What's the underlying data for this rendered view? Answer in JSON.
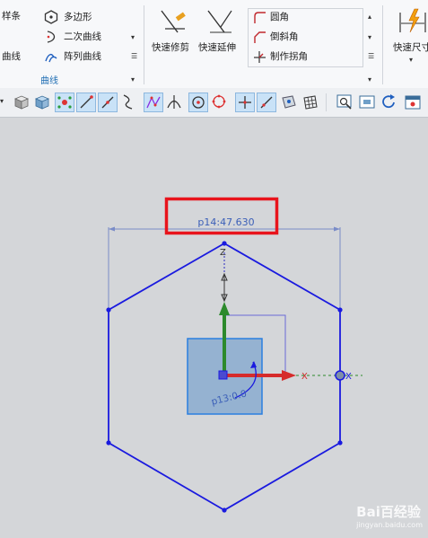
{
  "ribbon": {
    "col1": {
      "spline": "样条",
      "curve": "曲线"
    },
    "col2": {
      "polygon": "多边形",
      "conic": "二次曲线",
      "pattern_curve": "阵列曲线"
    },
    "group_label": "曲线",
    "quick_trim": "快速修剪",
    "quick_extend": "快速延伸",
    "col3": {
      "fillet": "圆角",
      "chamfer": "倒斜角",
      "make_corner": "制作拐角"
    },
    "quick_dimension": "快速尺寸"
  },
  "canvas": {
    "dimension_top": "p14:47.630",
    "dimension_angle": "p13:0.0",
    "axis_z": "Z",
    "axis_x": "X",
    "x_marker": "X"
  },
  "watermark": {
    "logo": "Bai百经验",
    "url": "jingyan.baidu.com"
  },
  "colors": {
    "hexagon": "#1a1adf",
    "highlight_box": "#e8141c",
    "axis_z": "#2c8a2c",
    "axis_x": "#d62b2b",
    "csys_square": "#8aabcf"
  }
}
